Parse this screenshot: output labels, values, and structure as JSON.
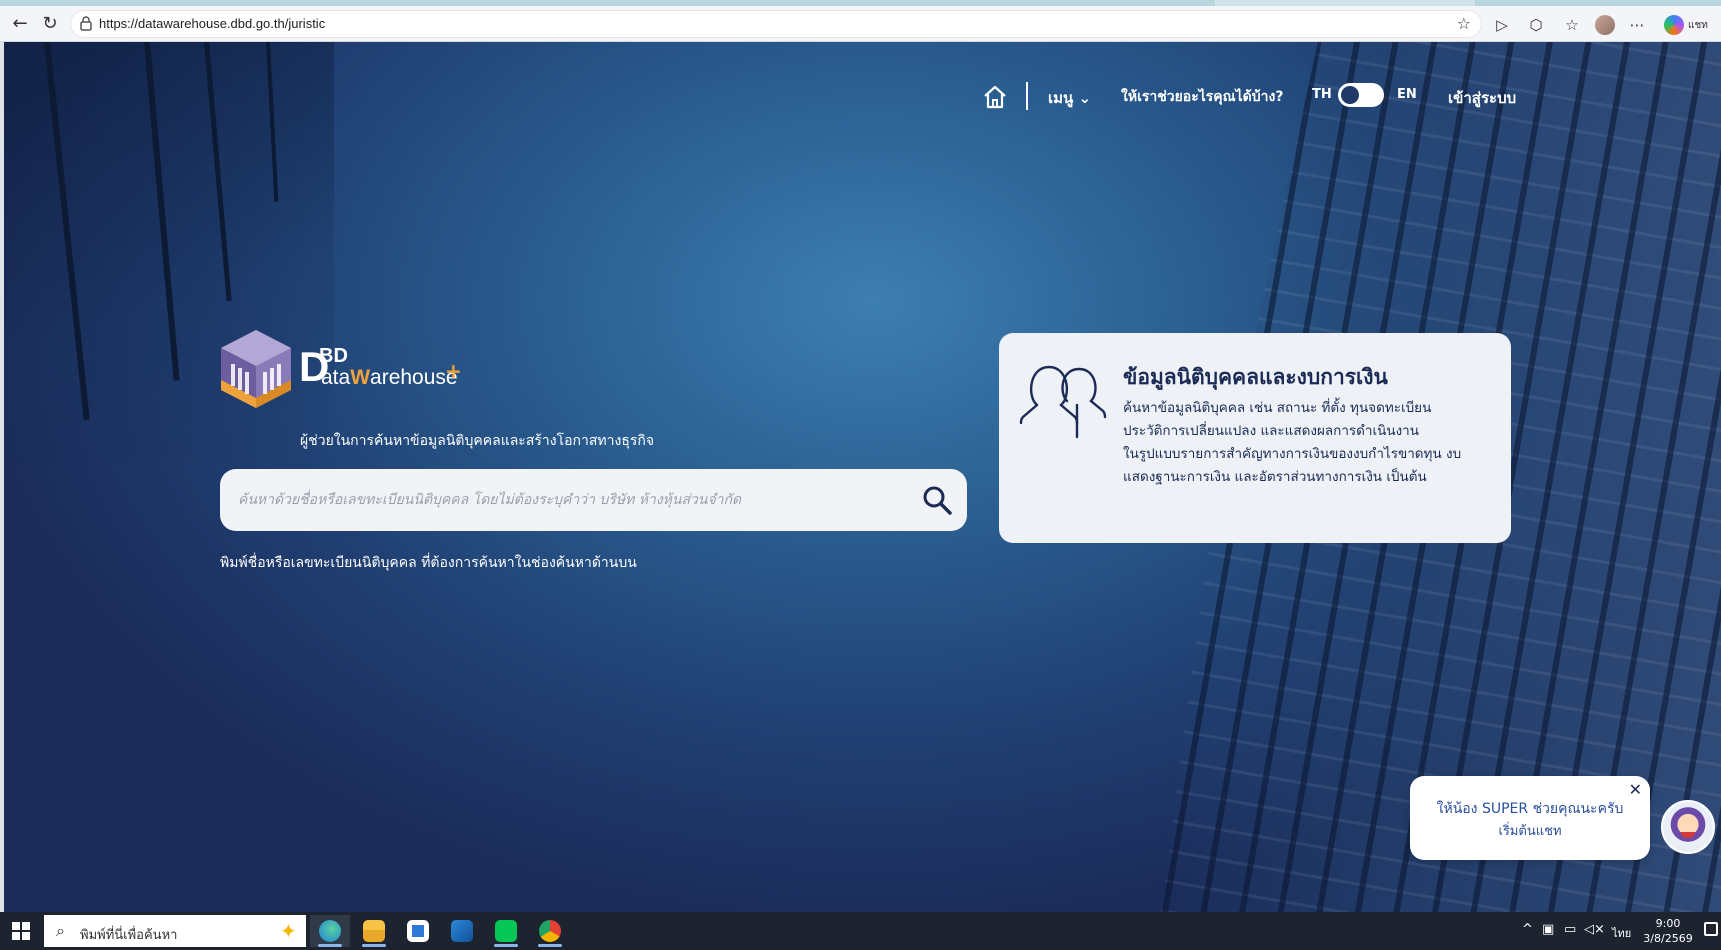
{
  "browser": {
    "url": "https://datawarehouse.dbd.go.th/juristic",
    "copilot_label": "แชท"
  },
  "nav": {
    "menu": "เมนู",
    "menu_chevron": "⌄",
    "help": "ให้เราช่วยอะไรคุณได้บ้าง?",
    "lang_th": "TH",
    "lang_en": "EN",
    "login": "เข้าสู่ระบบ"
  },
  "logo": {
    "d": "D",
    "bd": "BD",
    "data": "ata",
    "w": "W",
    "arehouse": "arehouse",
    "plus": "+",
    "tagline": "ผู้ช่วยในการค้นหาข้อมูลนิติบุคคลและสร้างโอกาสทางธุรกิจ"
  },
  "search": {
    "placeholder": "ค้นหาด้วยชื่อหรือเลขทะเบียนนิติบุคคล โดยไม่ต้องระบุคำว่า บริษัท ห้างหุ้นส่วนจำกัด",
    "hint": "พิมพ์ชื่อหรือเลขทะเบียนนิติบุคคล ที่ต้องการค้นหาในช่องค้นหาด้านบน"
  },
  "info_card": {
    "title": "ข้อมูลนิติบุคคลและงบการเงิน",
    "lines": [
      "ค้นหาข้อมูลนิติบุคคล เช่น สถานะ ที่ตั้ง ทุนจดทะเบียน",
      "ประวัติการเปลี่ยนแปลง และแสดงผลการดำเนินงาน",
      "ในรูปแบบรายการสำคัญทางการเงินของงบกำไรขาดทุน งบ",
      "แสดงฐานะการเงิน และอัตราส่วนทางการเงิน เป็นต้น"
    ]
  },
  "chat": {
    "line1": "ให้น้อง SUPER ช่วยคุณนะครับ",
    "line2": "เริ่มต้นแชท",
    "close": "✕"
  },
  "taskbar": {
    "search_text": "พิมพ์ที่นี่เพื่อค้นหา",
    "lang": "ไทย",
    "time": "9:00",
    "date": "3/8/2569"
  },
  "colors": {
    "page_navy": "#1b2c5a",
    "page_blue": "#3d7fb0",
    "card_bg": "#eef1f6",
    "text_dark": "#1b2b55",
    "accent_orange": "#f0a23a",
    "logo_purple": "#8a7ab8"
  }
}
